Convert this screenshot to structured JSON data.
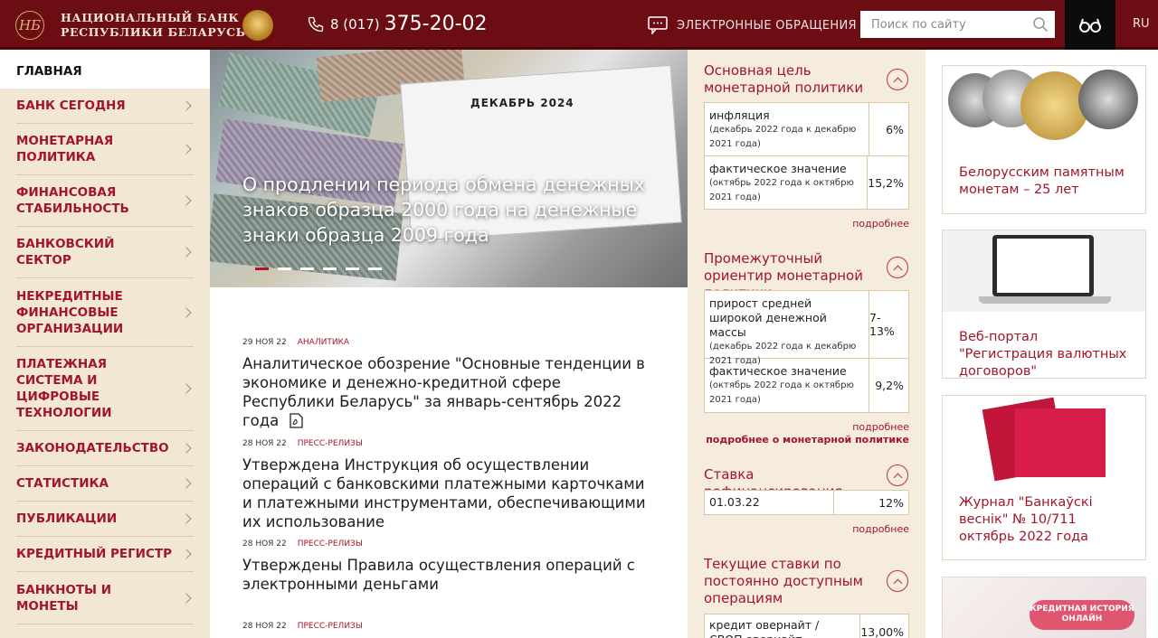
{
  "header": {
    "logo_line1": "НАЦИОНАЛЬНЫЙ БАНК",
    "logo_line2": "РЕСПУБЛИКИ БЕЛАРУСЬ",
    "phone_code": "8 (017)",
    "phone_number": "375-20-02",
    "appeals_label": "ЭЛЕКТРОННЫЕ ОБРАЩЕНИЯ",
    "search_placeholder": "Поиск по сайту",
    "lang": "RU"
  },
  "sidebar": {
    "home": "ГЛАВНАЯ",
    "items": [
      {
        "label": "БАНК СЕГОДНЯ"
      },
      {
        "label": "МОНЕТАРНАЯ ПОЛИТИКА"
      },
      {
        "label": "ФИНАНСОВАЯ СТАБИЛЬНОСТЬ"
      },
      {
        "label": "БАНКОВСКИЙ СЕКТОР"
      },
      {
        "label": "НЕКРЕДИТНЫЕ ФИНАНСОВЫЕ ОРГАНИЗАЦИИ"
      },
      {
        "label": "ПЛАТЕЖНАЯ СИСТЕМА И ЦИФРОВЫЕ ТЕХНОЛОГИИ"
      },
      {
        "label": "ЗАКОНОДАТЕЛЬСТВО"
      },
      {
        "label": "СТАТИСТИКА"
      },
      {
        "label": "ПУБЛИКАЦИИ"
      },
      {
        "label": "КРЕДИТНЫЙ РЕГИСТР"
      },
      {
        "label": "БАНКНОТЫ И МОНЕТЫ"
      }
    ]
  },
  "slider": {
    "calendar_month": "ДЕКАБРЬ 2024",
    "caption": "О продлении периода обмена денежных знаков образца 2000 года на денежные знаки образца 2009 года",
    "active_slide": 1,
    "slide_count": 6
  },
  "news": [
    {
      "date": "29 НОЯ 22",
      "category": "АНАЛИТИКА",
      "title": "Аналитическое обозрение \"Основные тенденции в экономике и денежно-кредитной сфере Республики Беларусь\" за январь-сентябрь 2022 года",
      "icon": "pdf-icon"
    },
    {
      "date": "28 НОЯ 22",
      "category": "ПРЕСС-РЕЛИЗЫ",
      "title": "Утверждена Инструкция об осуществлении операций с банковскими платежными карточками и платежными инструментами, обеспечивающими их использование"
    },
    {
      "date": "28 НОЯ 22",
      "category": "ПРЕСС-РЕЛИЗЫ",
      "title": "Утверждены Правила осуществления операций с электронными деньгами"
    },
    {
      "date": "28 НОЯ 22",
      "category": "ПРЕСС-РЕЛИЗЫ",
      "title": ""
    }
  ],
  "monetary": {
    "goal_title": "Основная цель монетарной политики",
    "goal_rows": [
      {
        "label": "инфляция",
        "sub": "(декабрь 2022 года к декабрю 2021 года)",
        "value": "6%"
      },
      {
        "label": "фактическое значение",
        "sub": "(октябрь 2022 года к октябрю 2021 года)",
        "value": "15,2%"
      }
    ],
    "goal_more": "подробнее",
    "target_title": "Промежуточный ориентир монетарной политики",
    "target_rows": [
      {
        "label": "прирост средней широкой денежной массы",
        "sub": "(декабрь 2022 года к декабрю 2021 года)",
        "value": "7-13%"
      },
      {
        "label": "фактическое значение",
        "sub": "(октябрь 2022 года к октябрю 2021 года)",
        "value": "9,2%"
      }
    ],
    "target_more": "подробнее",
    "policy_more": "подробнее о монетарной политике",
    "refinancing_title": "Ставка рефинансирования",
    "refinancing_date": "01.03.22",
    "refinancing_value": "12%",
    "refinancing_more": "подробнее",
    "standing_title": "Текущие ставки по постоянно доступным операциям",
    "standing_row_label": "кредит овернайт / СВОП овернайт",
    "standing_row_value": "13,00%"
  },
  "cards": [
    {
      "caption": "Белорусским памятным монетам – 25 лет"
    },
    {
      "caption": "Веб-портал \"Регистрация валютных договоров\""
    },
    {
      "caption": "Журнал \"Банкаўскі веснік\" № 10/711 октябрь 2022 года"
    },
    {
      "badge": "КРЕДИТНАЯ ИСТОРИЯ ОНЛАЙН"
    }
  ],
  "colors": {
    "header_bg": "#6b0d12",
    "accent": "#a1162a",
    "sidebar_bg": "#f2e7d3",
    "panel_bg": "#f5ecdd"
  }
}
